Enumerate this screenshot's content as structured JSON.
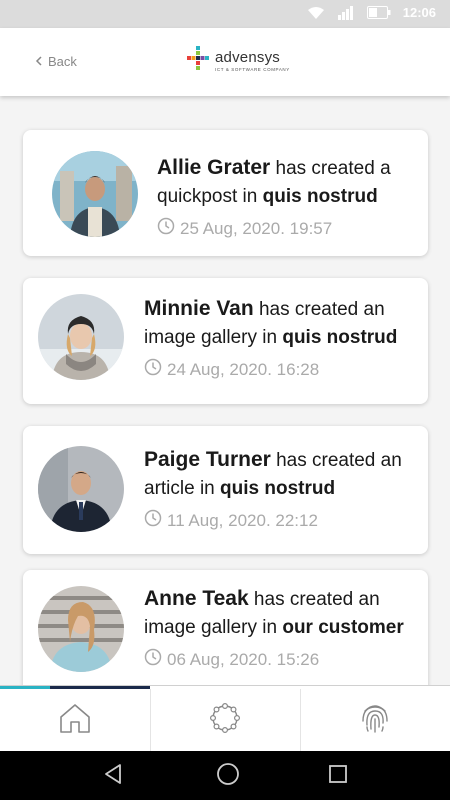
{
  "status_bar": {
    "time": "12:06",
    "icons": [
      "wifi-icon",
      "signal-icon",
      "battery-icon"
    ]
  },
  "header": {
    "back_label": "Back",
    "logo": {
      "name": "advensys",
      "tagline": "ICT & SOFTWARE COMPANY"
    }
  },
  "colors": {
    "tab_indicator": [
      "#2ab3c4",
      "#1b2a4a",
      "#1b2a4a"
    ]
  },
  "feed": [
    {
      "name": "Allie Grater",
      "action": " has created a quickpost in ",
      "place": "quis nostrud",
      "date": "25 Aug, 2020. 19:57"
    },
    {
      "name": "Minnie Van",
      "action": " has created an image gallery in ",
      "place": "quis nostrud",
      "date": "24 Aug, 2020. 16:28"
    },
    {
      "name": "Paige Turner",
      "action": " has created an article in ",
      "place": "quis nostrud",
      "date": "11 Aug, 2020. 22:12"
    },
    {
      "name": "Anne Teak",
      "action": " has created an image gallery in ",
      "place": "our customer",
      "date": "06 Aug, 2020. 15:26"
    }
  ],
  "tabs": [
    {
      "icon": "home-icon"
    },
    {
      "icon": "network-circle-icon"
    },
    {
      "icon": "fingerprint-icon"
    }
  ],
  "nav": [
    {
      "icon": "back-triangle-icon"
    },
    {
      "icon": "home-circle-icon"
    },
    {
      "icon": "recents-square-icon"
    }
  ]
}
